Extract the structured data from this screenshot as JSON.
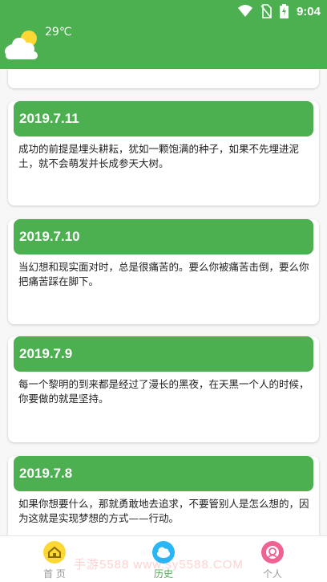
{
  "status_bar": {
    "time": "9:04"
  },
  "header": {
    "temperature": "29℃",
    "weather_icon": "sun-cloud-icon"
  },
  "cards": [
    {
      "date": "2019.7.11",
      "text": "成功的前提是埋头耕耘，犹如一颗饱满的种子，如果不先埋进泥土，就不会萌发并长成参天大树。"
    },
    {
      "date": "2019.7.10",
      "text": "当幻想和现实面对时，总是很痛苦的。要么你被痛苦击倒，要么你把痛苦踩在脚下。"
    },
    {
      "date": "2019.7.9",
      "text": "每一个黎明的到来都是经过了漫长的黑夜，在天黑一个人的时候，你要做的就是坚持。"
    },
    {
      "date": "2019.7.8",
      "text": "如果你想要什么，那就勇敢地去追求，不要管别人是怎么想的，因为这就是实现梦想的方式——行动。"
    }
  ],
  "bottom_nav": [
    {
      "label": "首 页",
      "icon": "home-icon",
      "color": "#fdd835"
    },
    {
      "label": "历史",
      "icon": "cloud-icon",
      "color": "#29b6f6",
      "active": true
    },
    {
      "label": "个人",
      "icon": "person-icon",
      "color": "#f06292"
    }
  ],
  "watermark": "手游5588  www.sy5588.COM",
  "colors": {
    "primary": "#4caf50"
  }
}
